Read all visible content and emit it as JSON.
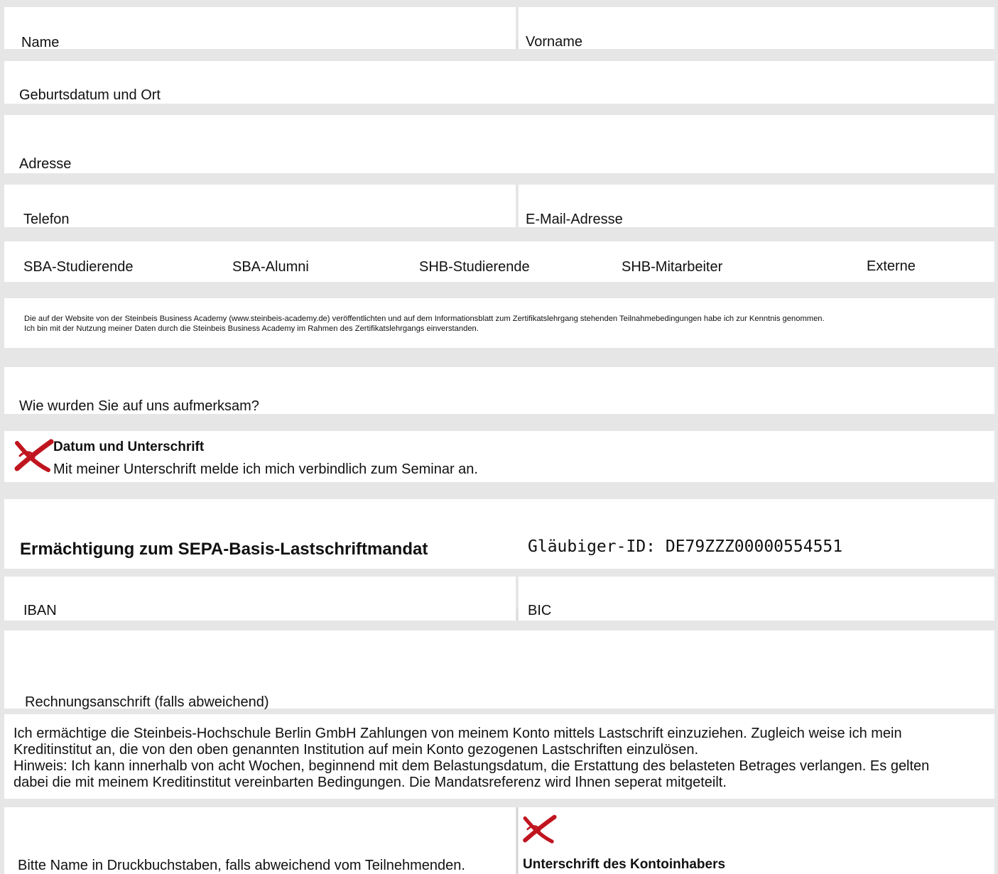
{
  "personal": {
    "name_label": "Name",
    "vorname_label": "Vorname",
    "birth_label": "Geburtsdatum und Ort",
    "address_label": "Adresse",
    "phone_label": "Telefon",
    "email_label": "E-Mail-Adresse"
  },
  "categories": [
    "SBA-Studierende",
    "SBA-Alumni",
    "SHB-Studierende",
    "SHB-Mitarbeiter",
    "Externe"
  ],
  "consent": {
    "line1": "Die auf der Website von der Steinbeis Business Academy (www.steinbeis-academy.de) veröffentlichten und auf dem Informationsblatt zum Zertifikatslehrgang stehenden Teilnahmebedingungen habe ich zur Kenntnis genommen.",
    "line2": "Ich bin mit der Nutzung meiner Daten durch die Steinbeis Business Academy im Rahmen des Zertifikatslehrgangs einverstanden."
  },
  "attention_label": "Wie wurden Sie auf uns aufmerksam?",
  "signature": {
    "title": "Datum und Unterschrift",
    "text": "Mit meiner Unterschrift melde ich mich verbindlich zum Seminar an."
  },
  "sepa": {
    "title": "Ermächtigung zum SEPA-Basis-Lastschriftmandat",
    "creditor_id": "Gläubiger-ID: DE79ZZZ00000554551",
    "iban_label": "IBAN",
    "bic_label": "BIC",
    "billing_label": "Rechnungsanschrift (falls abweichend)",
    "mandate_line1": "Ich ermächtige die Steinbeis-Hochschule Berlin GmbH Zahlungen von meinem Konto mittels Lastschrift einzuziehen. Zugleich weise ich mein",
    "mandate_line2": "Kreditinstitut an, die von den oben genannten Institution auf mein Konto gezogenen Lastschriften einzulösen.",
    "mandate_line3": "Hinweis: Ich kann innerhalb von acht Wochen, beginnend mit dem Belastungsdatum, die Erstattung des belasteten Betrages verlangen. Es gelten",
    "mandate_line4": "dabei die mit meinem Kreditinstitut vereinbarten Bedingungen. Die Mandatsreferenz wird Ihnen seperat mitgeteilt.",
    "print_name_label": "Bitte Name in Druckbuchstaben, falls abweichend vom Teilnehmenden.",
    "holder_signature_label": "Unterschrift des Kontoinhabers"
  },
  "colors": {
    "cross": "#c0151f",
    "background": "#e6e6e6"
  }
}
